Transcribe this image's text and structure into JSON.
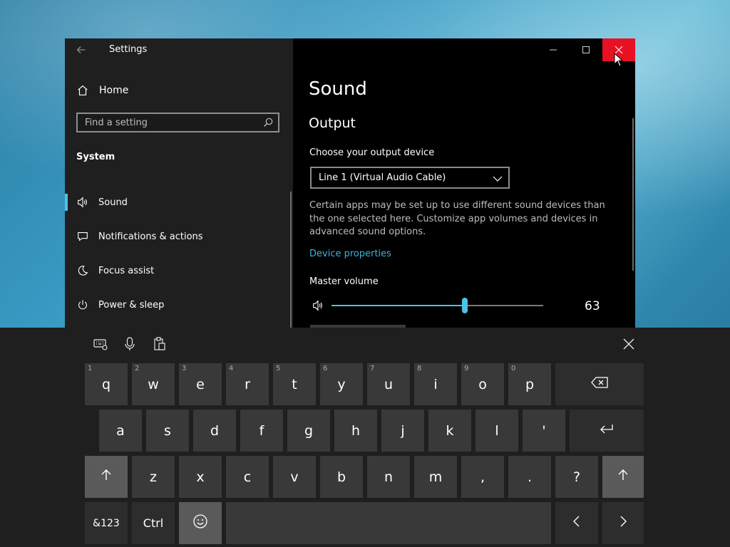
{
  "window": {
    "title": "Settings",
    "home_label": "Home",
    "search_placeholder": "Find a setting",
    "section": "System",
    "nav_items": [
      {
        "label": "Sound",
        "icon": "speaker-icon",
        "active": true
      },
      {
        "label": "Notifications & actions",
        "icon": "notification-icon",
        "active": false
      },
      {
        "label": "Focus assist",
        "icon": "moon-icon",
        "active": false
      },
      {
        "label": "Power & sleep",
        "icon": "power-icon",
        "active": false
      }
    ]
  },
  "content": {
    "page_title": "Sound",
    "output_heading": "Output",
    "choose_label": "Choose your output device",
    "device_value": "Line 1 (Virtual Audio Cable)",
    "description": "Certain apps may be set up to use different sound devices than the one selected here. Customize app volumes and devices in advanced sound options.",
    "device_properties_link": "Device properties",
    "master_volume_label": "Master volume",
    "volume": 63,
    "volume_max": 100
  },
  "colors": {
    "accent": "#4cc2e6",
    "link": "#3fb3d8",
    "close_hover": "#e81123"
  },
  "keyboard": {
    "row1": [
      {
        "key": "q",
        "num": "1"
      },
      {
        "key": "w",
        "num": "2"
      },
      {
        "key": "e",
        "num": "3"
      },
      {
        "key": "r",
        "num": "4"
      },
      {
        "key": "t",
        "num": "5"
      },
      {
        "key": "y",
        "num": "6"
      },
      {
        "key": "u",
        "num": "7"
      },
      {
        "key": "i",
        "num": "8"
      },
      {
        "key": "o",
        "num": "9"
      },
      {
        "key": "p",
        "num": "0"
      }
    ],
    "row2": [
      "a",
      "s",
      "d",
      "f",
      "g",
      "h",
      "j",
      "k",
      "l",
      "'"
    ],
    "row3": [
      "z",
      "x",
      "c",
      "v",
      "b",
      "n",
      "m",
      ",",
      ".",
      "?"
    ],
    "symbols_label": "&123",
    "ctrl_label": "Ctrl",
    "backspace_icon": "backspace-icon",
    "enter_icon": "enter-icon",
    "shift_icon": "shift-up-icon"
  }
}
